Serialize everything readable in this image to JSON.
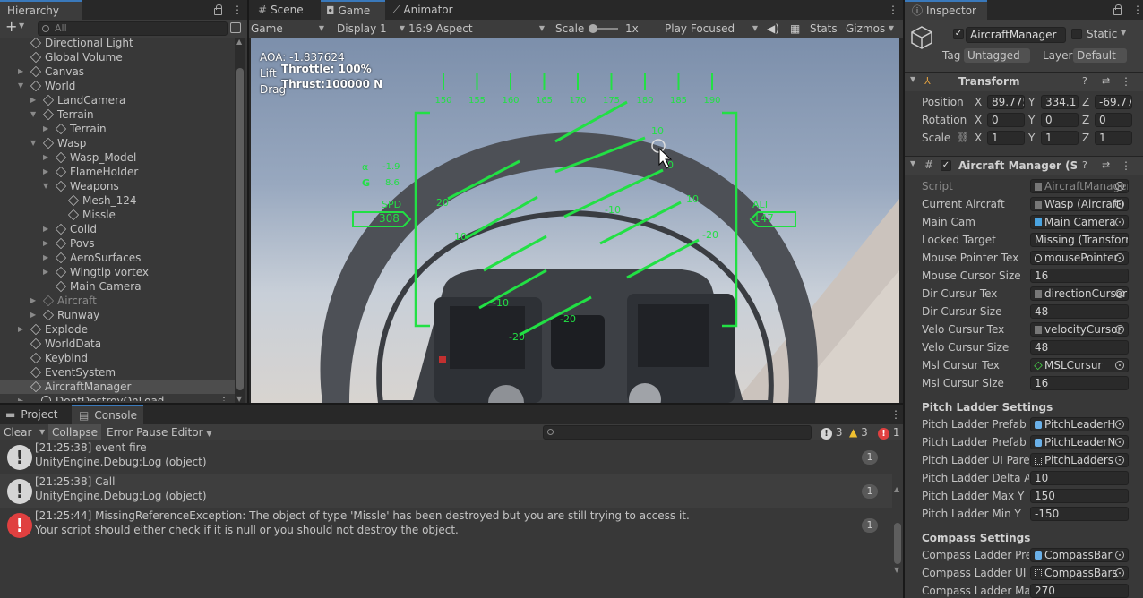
{
  "hierarchy": {
    "tab": "Hierarchy",
    "search_placeholder": "All",
    "rows": [
      {
        "label": "Directional Light",
        "depth": 1,
        "arrow": "",
        "dim": false
      },
      {
        "label": "Global Volume",
        "depth": 1,
        "arrow": "",
        "dim": false
      },
      {
        "label": "Canvas",
        "depth": 1,
        "arrow": "▶",
        "dim": false
      },
      {
        "label": "World",
        "depth": 1,
        "arrow": "▼",
        "dim": false
      },
      {
        "label": "LandCamera",
        "depth": 2,
        "arrow": "▶",
        "dim": false
      },
      {
        "label": "Terrain",
        "depth": 2,
        "arrow": "▼",
        "dim": false
      },
      {
        "label": "Terrain",
        "depth": 3,
        "arrow": "▶",
        "dim": false
      },
      {
        "label": "Wasp",
        "depth": 2,
        "arrow": "▼",
        "dim": false
      },
      {
        "label": "Wasp_Model",
        "depth": 3,
        "arrow": "▶",
        "dim": false
      },
      {
        "label": "FlameHolder",
        "depth": 3,
        "arrow": "▶",
        "dim": false
      },
      {
        "label": "Weapons",
        "depth": 3,
        "arrow": "▼",
        "dim": false
      },
      {
        "label": "Mesh_124",
        "depth": 4,
        "arrow": "",
        "dim": false
      },
      {
        "label": "Missle",
        "depth": 4,
        "arrow": "",
        "dim": false
      },
      {
        "label": "Colid",
        "depth": 3,
        "arrow": "▶",
        "dim": false
      },
      {
        "label": "Povs",
        "depth": 3,
        "arrow": "▶",
        "dim": false
      },
      {
        "label": "AeroSurfaces",
        "depth": 3,
        "arrow": "▶",
        "dim": false
      },
      {
        "label": "Wingtip vortex",
        "depth": 3,
        "arrow": "▶",
        "dim": false
      },
      {
        "label": "Main Camera",
        "depth": 3,
        "arrow": "",
        "dim": false
      },
      {
        "label": "Aircraft",
        "depth": 2,
        "arrow": "▶",
        "dim": true
      },
      {
        "label": "Runway",
        "depth": 2,
        "arrow": "▶",
        "dim": false
      },
      {
        "label": "Explode",
        "depth": 1,
        "arrow": "▶",
        "dim": false
      },
      {
        "label": "WorldData",
        "depth": 1,
        "arrow": "",
        "dim": false
      },
      {
        "label": "Keybind",
        "depth": 1,
        "arrow": "",
        "dim": false
      },
      {
        "label": "EventSystem",
        "depth": 1,
        "arrow": "",
        "dim": false
      },
      {
        "label": "AircraftManager",
        "depth": 1,
        "arrow": "",
        "dim": false,
        "selected": true
      },
      {
        "label": "DontDestroyOnLoad",
        "depth": 0,
        "arrow": "▶",
        "dim": false
      }
    ]
  },
  "tabs": {
    "scene": "Scene",
    "game": "Game",
    "animator": "Animator"
  },
  "game_toolbar": {
    "mode": "Game",
    "display": "Display 1",
    "aspect": "16:9 Aspect",
    "scale_label": "Scale",
    "scale_value": "1x",
    "play": "Play Focused",
    "stats": "Stats",
    "gizmos": "Gizmos"
  },
  "hud": {
    "aoa": "AOA: -1.837624",
    "lift": "Lift",
    "drag": "Drag",
    "throttle": "Throttle: 100%",
    "thrust": "Thrust:100000 N",
    "compass": [
      "150",
      "155",
      "160",
      "165",
      "170",
      "175",
      "180",
      "185",
      "190"
    ],
    "alpha_label": "α",
    "alpha_val": "-1.9",
    "g_label": "G",
    "g_val": "8.6",
    "spd_label": "SPD",
    "spd_val": "308",
    "alt_label": "ALT",
    "alt_val": "147",
    "ladder_labels": [
      "10",
      "20",
      "-10",
      "10",
      "-20",
      "0",
      "10",
      "-20",
      "-10",
      "-20"
    ],
    "color": "#22e044"
  },
  "console": {
    "tabs": {
      "project": "Project",
      "console": "Console"
    },
    "buttons": {
      "clear": "Clear",
      "collapse": "Collapse",
      "error_pause": "Error Pause",
      "editor": "Editor"
    },
    "counts": {
      "log": "3",
      "warn": "3",
      "error": "1"
    },
    "messages": [
      {
        "type": "log",
        "line1": "[21:25:38] event fire",
        "line2": "UnityEngine.Debug:Log (object)",
        "count": "1"
      },
      {
        "type": "log",
        "line1": "[21:25:38] Call",
        "line2": "UnityEngine.Debug:Log (object)",
        "count": "1"
      },
      {
        "type": "error",
        "line1": "[21:25:44] MissingReferenceException: The object of type 'Missle' has been destroyed but you are still trying to access it.",
        "line2": "Your script should either check if it is null or you should not destroy the object.",
        "count": "1"
      }
    ]
  },
  "inspector": {
    "tab": "Inspector",
    "object_name": "AircraftManager",
    "static": "Static",
    "tag_label": "Tag",
    "tag_value": "Untagged",
    "layer_label": "Layer",
    "layer_value": "Default",
    "transform": {
      "title": "Transform",
      "position": {
        "label": "Position",
        "x": "89.775",
        "y": "334.1",
        "z": "-69.77"
      },
      "rotation": {
        "label": "Rotation",
        "x": "0",
        "y": "0",
        "z": "0"
      },
      "scale": {
        "label": "Scale",
        "x": "1",
        "y": "1",
        "z": "1"
      }
    },
    "script_title": "Aircraft Manager (Script)",
    "props": [
      {
        "label": "Script",
        "value": "AircraftManager",
        "icon": "script-icon",
        "dim": true
      },
      {
        "label": "Current Aircraft",
        "value": "Wasp (Aircraft)",
        "icon": "script-icon"
      },
      {
        "label": "Main Cam",
        "value": "Main Camera",
        "icon": "camera-icon"
      },
      {
        "label": "Locked Target",
        "value": "Missing (Transform)",
        "icon": ""
      },
      {
        "label": "Mouse Pointer Tex",
        "value": "mousePointer",
        "icon": "circle-texture-icon"
      },
      {
        "label": "Mouse Cursor Size",
        "value": "16",
        "icon": ""
      },
      {
        "label": "Dir Cursur Tex",
        "value": "directionCursor",
        "icon": "texture-icon"
      },
      {
        "label": "Dir Cursur Size",
        "value": "48",
        "icon": ""
      },
      {
        "label": "Velo Cursur Tex",
        "value": "velocityCursor",
        "icon": "texture-icon"
      },
      {
        "label": "Velo Cursur Size",
        "value": "48",
        "icon": ""
      },
      {
        "label": "Msl Cursur Tex",
        "value": "MSLCursur",
        "icon": "diamond-texture-icon"
      },
      {
        "label": "Msl Cursur Size",
        "value": "16",
        "icon": ""
      }
    ],
    "pitch_header": "Pitch Ladder Settings",
    "pitch_props": [
      {
        "label": "Pitch Ladder Prefab H",
        "value": "PitchLeaderH",
        "icon": "prefab-icon"
      },
      {
        "label": "Pitch Ladder Prefab N",
        "value": "PitchLeaderN",
        "icon": "prefab-icon"
      },
      {
        "label": "Pitch Ladder UI Parent",
        "value": "PitchLadders",
        "icon": "rect-icon"
      },
      {
        "label": "Pitch Ladder Delta Angle",
        "value": "10",
        "icon": ""
      },
      {
        "label": "Pitch Ladder Max Y",
        "value": "150",
        "icon": ""
      },
      {
        "label": "Pitch Ladder Min Y",
        "value": "-150",
        "icon": ""
      }
    ],
    "compass_header": "Compass Settings",
    "compass_props": [
      {
        "label": "Compass Ladder Prefab",
        "value": "CompassBar",
        "icon": "prefab-icon"
      },
      {
        "label": "Compass Ladder UI Parent",
        "value": "CompassBars",
        "icon": "rect-icon"
      },
      {
        "label": "Compass Ladder Max",
        "value": "270",
        "icon": ""
      }
    ]
  }
}
